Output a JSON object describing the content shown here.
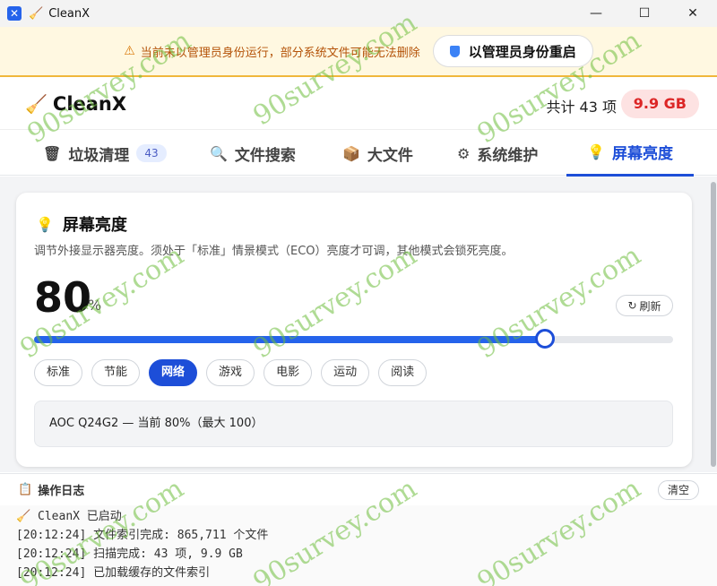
{
  "window": {
    "title": "CleanX",
    "icon_label": "✕",
    "minimize": "—",
    "maximize": "☐",
    "close": "✕"
  },
  "warning": {
    "text": "当前未以管理员身份运行，部分系统文件可能无法删除",
    "button": "以管理员身份重启"
  },
  "header": {
    "brand": "CleanX",
    "total": "共计 43 项",
    "size": "9.9 GB"
  },
  "tabs": [
    {
      "label": "垃圾清理",
      "badge": "43",
      "icon": "trash-icon"
    },
    {
      "label": "文件搜索",
      "icon": "search-icon"
    },
    {
      "label": "大文件",
      "icon": "box-icon"
    },
    {
      "label": "系统维护",
      "icon": "gear-icon"
    },
    {
      "label": "屏幕亮度",
      "icon": "bulb-icon",
      "active": true
    }
  ],
  "brightness": {
    "title": "屏幕亮度",
    "description": "调节外接显示器亮度。须处于「标准」情景模式（ECO）亮度才可调，其他模式会锁死亮度。",
    "value": "80",
    "unit": "%",
    "level": 0.8,
    "refresh": "刷新",
    "modes": [
      "标准",
      "节能",
      "网络",
      "游戏",
      "电影",
      "运动",
      "阅读"
    ],
    "active_mode": "网络",
    "monitor_info": "AOC Q24G2 — 当前 80%（最大 100）"
  },
  "log": {
    "title": "操作日志",
    "clear": "清空",
    "lines": [
      "🧹 CleanX 已启动",
      "[20:12:24] 文件索引完成: 865,711 个文件",
      "[20:12:24] 扫描完成: 43 项, 9.9 GB",
      "[20:12:24] 已加载缓存的文件索引"
    ]
  },
  "watermark": "90survey.com",
  "colors": {
    "accent": "#1d4ed8",
    "warning": "#b45309",
    "danger": "#dc2626"
  }
}
